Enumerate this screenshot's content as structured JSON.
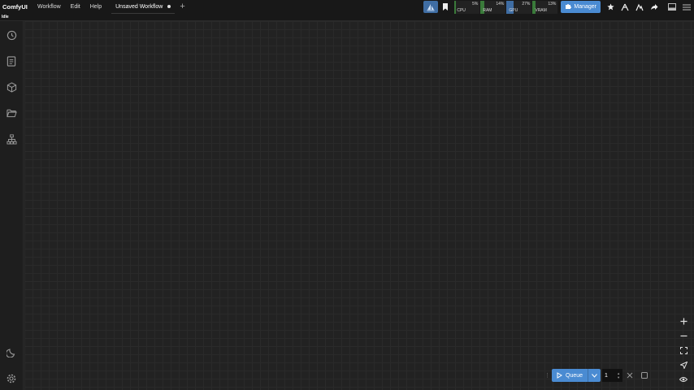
{
  "topbar": {
    "brand": "ComfyUI",
    "menu": [
      "Workflow",
      "Edit",
      "Help"
    ],
    "tab_label": "Unsaved Workflow",
    "add_tab": "+"
  },
  "monitor": [
    {
      "label": "CPU",
      "pct": "5%",
      "fraction": 0.05,
      "color": "#3a7a3a"
    },
    {
      "label": "RAM",
      "pct": "14%",
      "fraction": 0.14,
      "color": "#3a7a3a"
    },
    {
      "label": "GPU",
      "pct": "27%",
      "fraction": 0.27,
      "color": "#3f6da3"
    },
    {
      "label": "VRAM",
      "pct": "13%",
      "fraction": 0.13,
      "color": "#3a7a3a"
    }
  ],
  "manager_label": "Manager",
  "status": "Idle",
  "queue": {
    "label": "Queue",
    "batch_count": "1"
  },
  "colors": {
    "accent": "#4a8bd2",
    "background": "#202020"
  }
}
